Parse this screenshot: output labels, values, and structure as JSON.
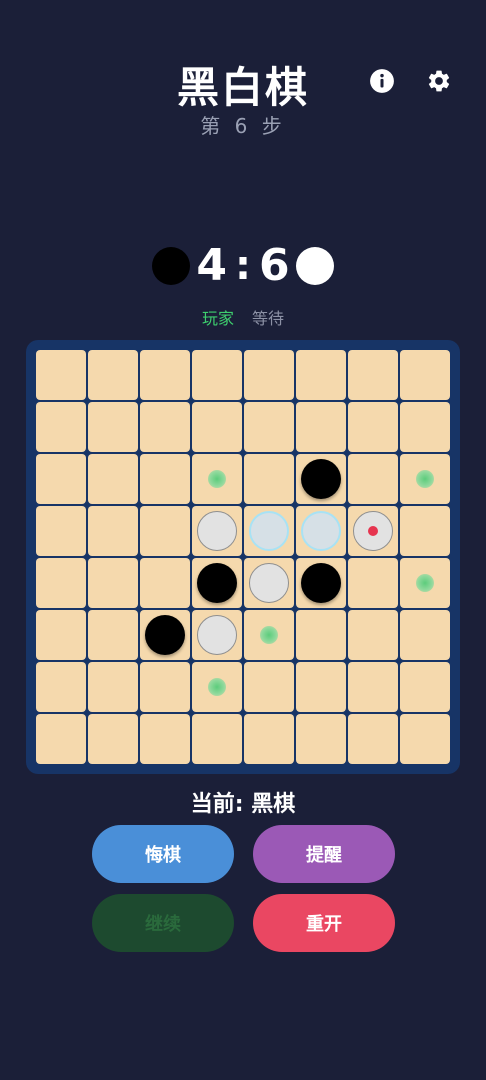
{
  "header": {
    "title": "黑白棋",
    "step_text": "第 6 步"
  },
  "score": {
    "black": "4",
    "colon": ":",
    "white": "6"
  },
  "turn_labels": {
    "player": "玩家",
    "waiting": "等待"
  },
  "board": {
    "size": 8,
    "legend": {
      ".": "empty",
      "B": "black",
      "W": "white",
      "F": "white-flipping",
      "L": "white-last-move",
      "h": "legal-move-hint"
    },
    "rows": [
      "........",
      "........",
      "...h.B.h",
      "...WFFL.",
      "...BWB.h",
      "..BWh...",
      "...h....",
      "........"
    ]
  },
  "status": {
    "current_turn": "当前: 黑棋"
  },
  "buttons": {
    "undo": "悔棋",
    "hint": "提醒",
    "continue": "继续",
    "restart": "重开"
  },
  "colors": {
    "background": "#1b1f38",
    "board_frame": "#173466",
    "cell": "#f5d9ad",
    "player_active": "#3ecf6e",
    "undo": "#4a8fd8",
    "hint": "#9b59b6",
    "continue_disabled": "#1d4a2f",
    "restart": "#ea4762",
    "last_move_marker": "#e6344f"
  },
  "icons": {
    "info": "info-icon",
    "settings": "gear-icon"
  }
}
